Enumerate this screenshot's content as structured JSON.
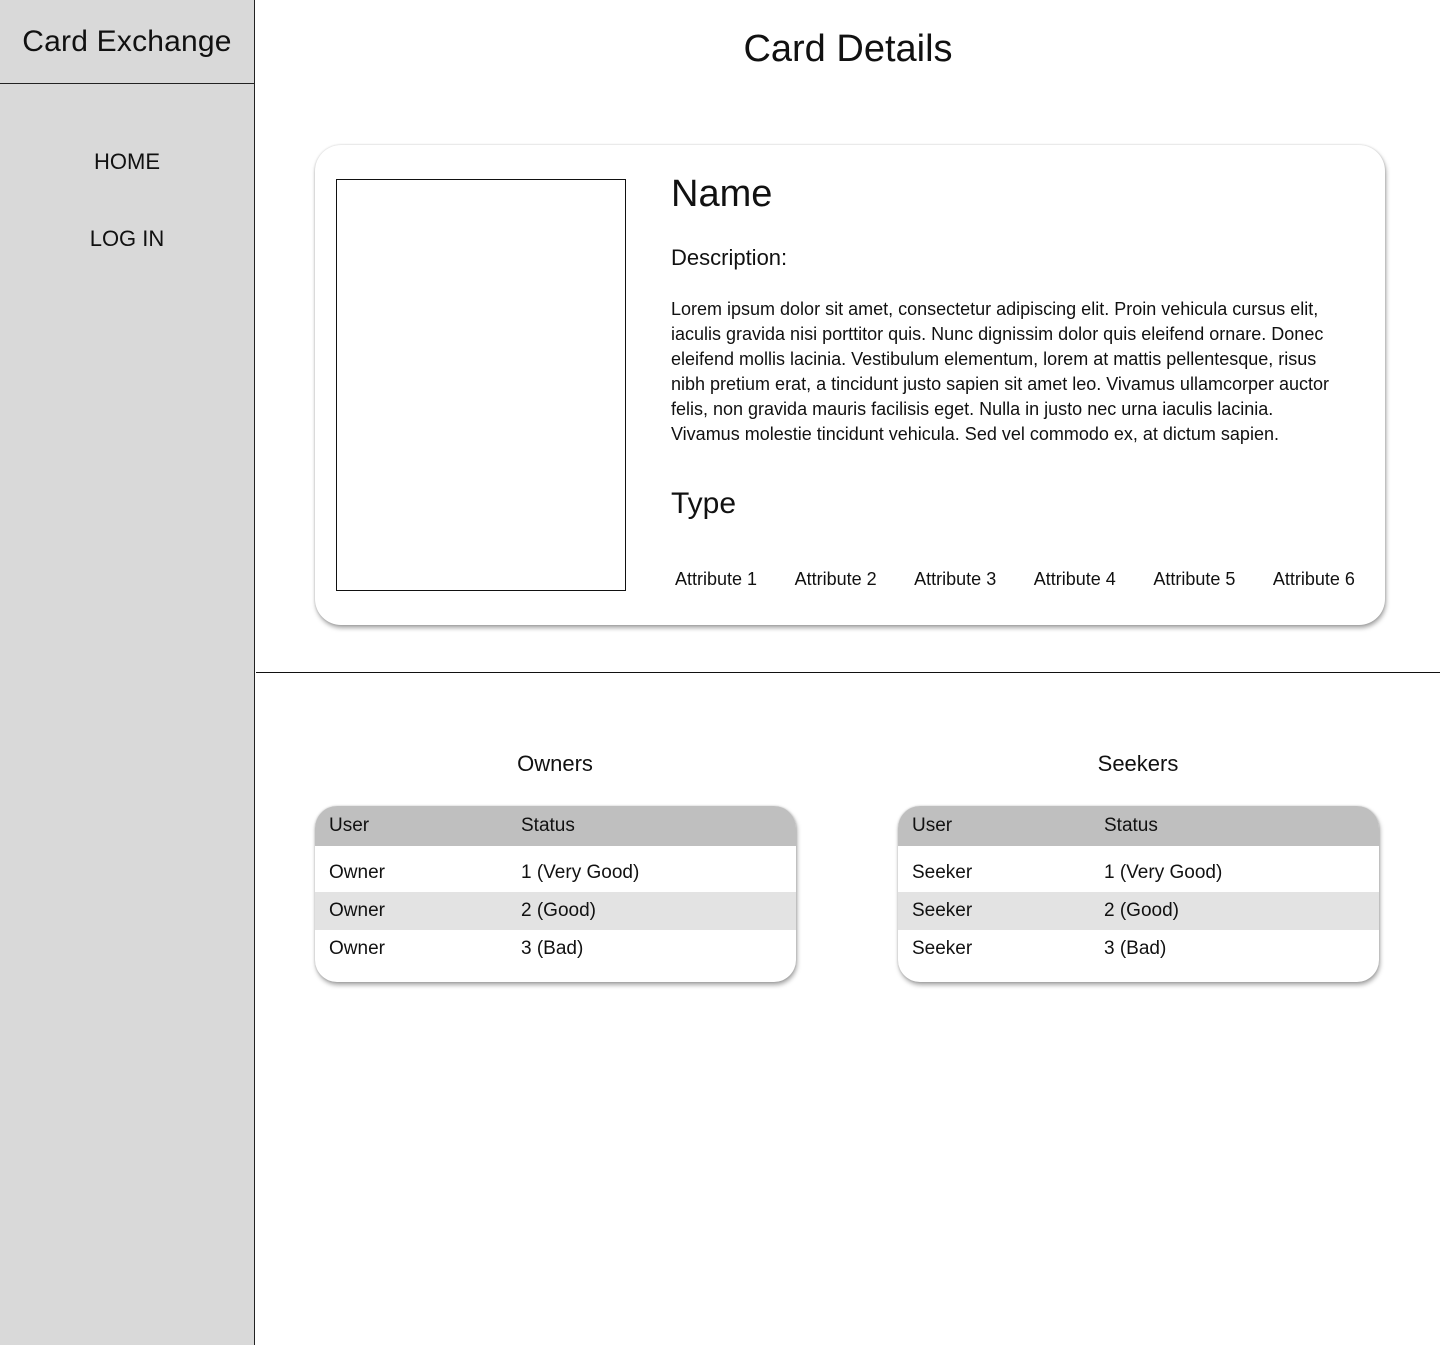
{
  "sidebar": {
    "brand": "Card Exchange",
    "nav": [
      {
        "label": "HOME"
      },
      {
        "label": "LOG IN"
      }
    ]
  },
  "page": {
    "title": "Card Details"
  },
  "card": {
    "name": "Name",
    "description_label": "Description:",
    "description": "Lorem ipsum dolor sit amet, consectetur adipiscing elit. Proin vehicula cursus elit, iaculis gravida nisi porttitor quis. Nunc dignissim dolor quis eleifend ornare. Donec eleifend mollis lacinia. Vestibulum elementum, lorem at mattis pellentesque, risus nibh pretium erat, a tincidunt justo sapien sit amet leo. Vivamus ullamcorper auctor felis, non gravida mauris facilisis eget. Nulla in justo nec urna iaculis lacinia. Vivamus molestie tincidunt vehicula. Sed vel commodo ex, at dictum sapien.",
    "type": "Type",
    "attributes": [
      "Attribute 1",
      "Attribute 2",
      "Attribute 3",
      "Attribute 4",
      "Attribute 5",
      "Attribute 6"
    ]
  },
  "owners": {
    "title": "Owners",
    "columns": [
      "User",
      "Status"
    ],
    "rows": [
      {
        "user": "Owner",
        "status": "1 (Very Good)"
      },
      {
        "user": "Owner",
        "status": "2 (Good)"
      },
      {
        "user": "Owner",
        "status": "3 (Bad)"
      }
    ]
  },
  "seekers": {
    "title": "Seekers",
    "columns": [
      "User",
      "Status"
    ],
    "rows": [
      {
        "user": "Seeker",
        "status": "1 (Very Good)"
      },
      {
        "user": "Seeker",
        "status": "2 (Good)"
      },
      {
        "user": "Seeker",
        "status": "3 (Bad)"
      }
    ]
  }
}
